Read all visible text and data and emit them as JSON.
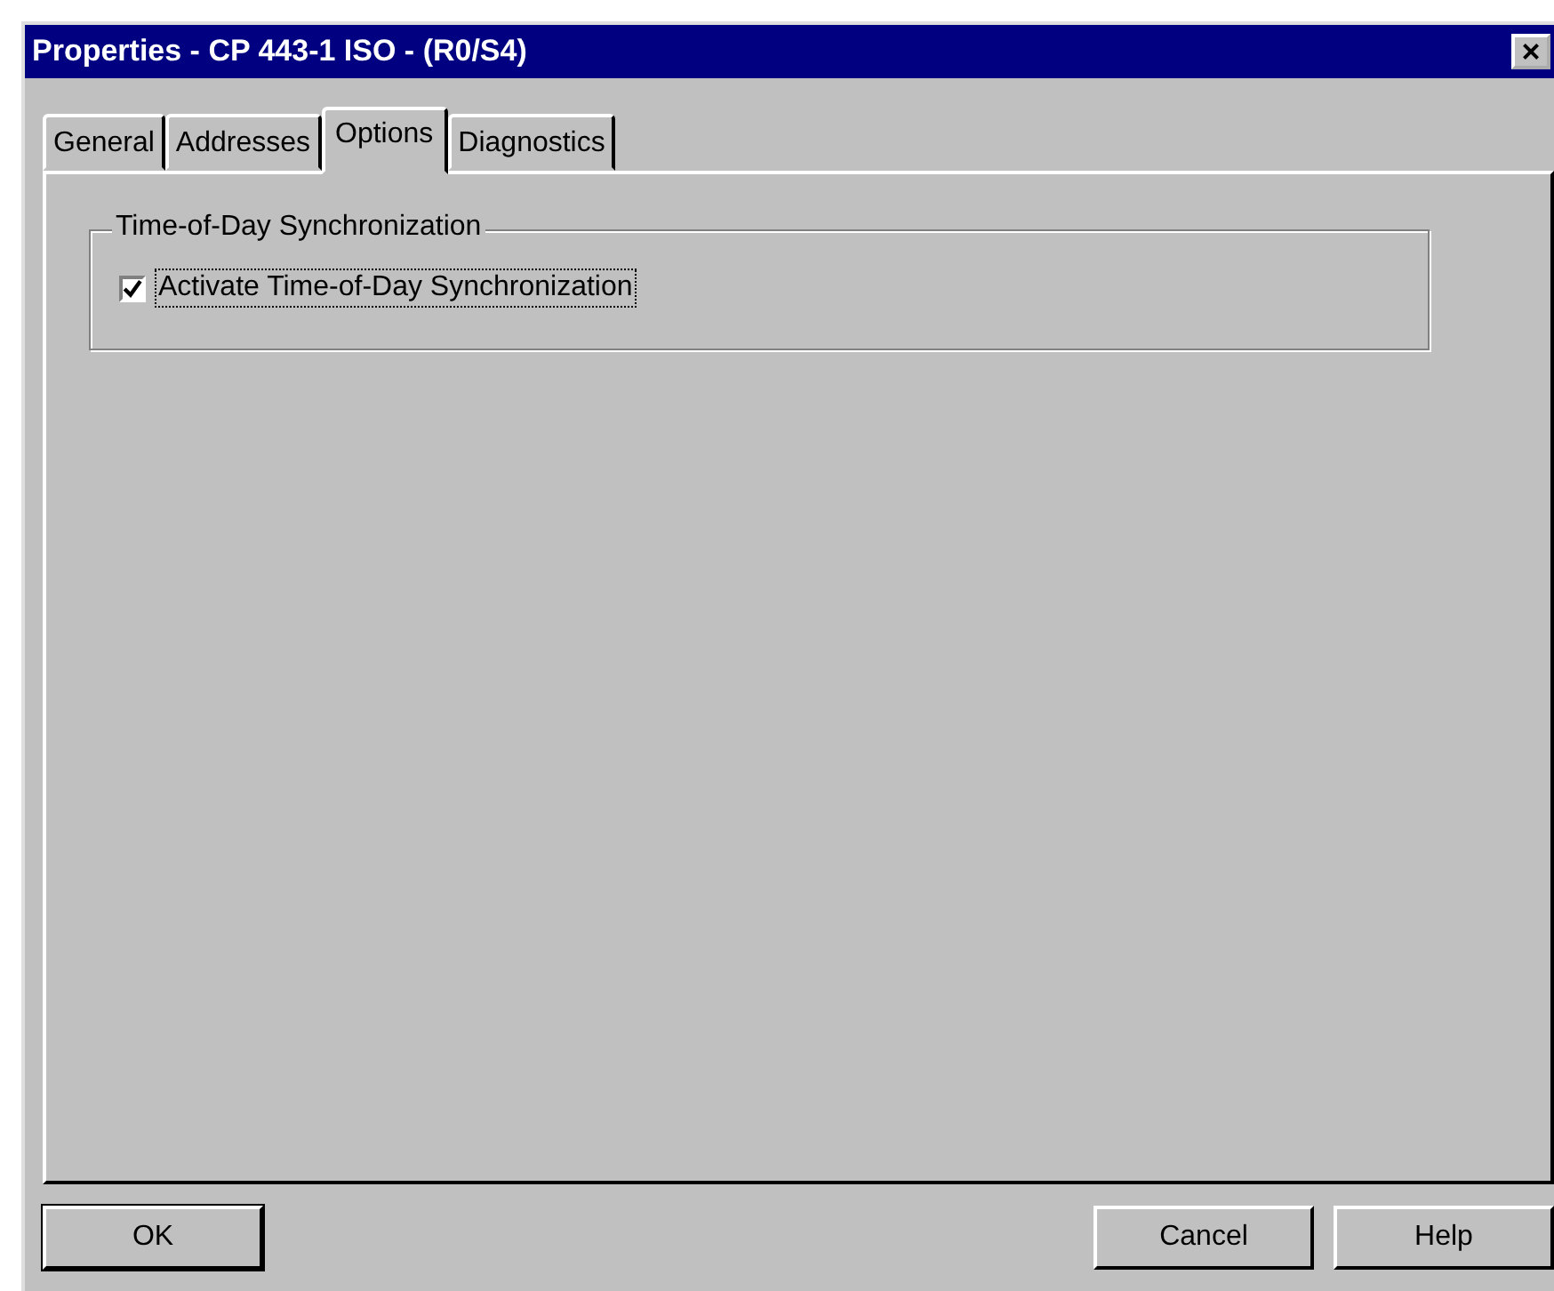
{
  "window": {
    "title": "Properties - CP 443-1 ISO - (R0/S4)",
    "close": "×"
  },
  "tabs": [
    {
      "label": "General",
      "selected": false
    },
    {
      "label": "Addresses",
      "selected": false
    },
    {
      "label": "Options",
      "selected": true
    },
    {
      "label": "Diagnostics",
      "selected": false
    }
  ],
  "group": {
    "title": "Time-of-Day Synchronization",
    "checkbox": {
      "label": "Activate Time-of-Day Synchronization",
      "checked": true
    }
  },
  "buttons": [
    "OK",
    "Cancel",
    "Help"
  ]
}
